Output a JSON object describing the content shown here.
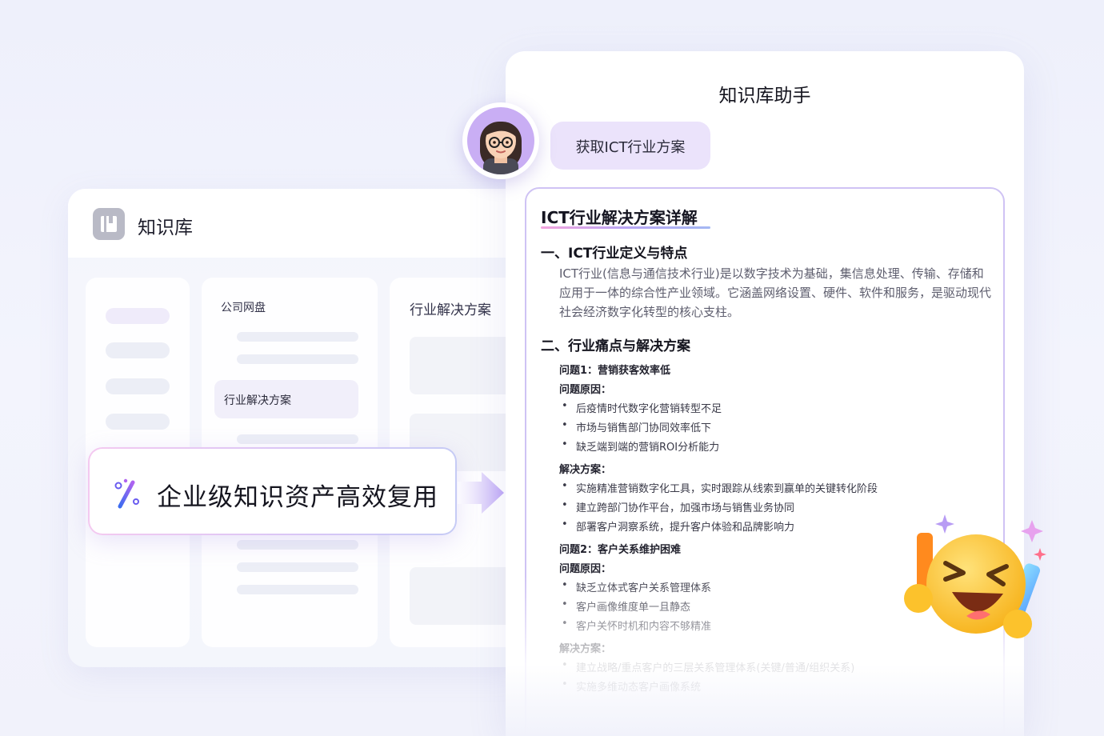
{
  "knowledge_base": {
    "title": "知识库",
    "folders": {
      "root_label": "公司网盘",
      "selected_item": "行业解决方案"
    },
    "content_title": "行业解决方案"
  },
  "callout": {
    "text": "企业级知识资产高效复用"
  },
  "assistant": {
    "title": "知识库助手",
    "user_message": "获取ICT行业方案",
    "answer": {
      "title": "ICT行业解决方案详解",
      "section1": {
        "heading": "一、ICT行业定义与特点",
        "body": "ICT行业(信息与通信技术行业)是以数字技术为基础，集信息处理、传输、存储和应用于一体的综合性产业领域。它涵盖网络设置、硬件、软件和服务，是驱动现代社会经济数字化转型的核心支柱。"
      },
      "section2": {
        "heading": "二、行业痛点与解决方案",
        "problem1": "问题1：营销获客效率低",
        "cause_label1": "问题原因：",
        "causes1": [
          "后疫情时代数字化营销转型不足",
          "市场与销售部门协同效率低下",
          "缺乏端到端的营销ROI分析能力"
        ],
        "solution_label1": "解决方案：",
        "solutions1": [
          "实施精准营销数字化工具，实时跟踪从线索到赢单的关键转化阶段",
          "建立跨部门协作平台，加强市场与销售业务协同",
          "部署客户洞察系统，提升客户体验和品牌影响力"
        ],
        "problem2": "问题2：客户关系维护困难",
        "cause_label2": "问题原因：",
        "causes2": [
          "缺乏立体式客户关系管理体系",
          "客户画像维度单一且静态",
          "客户关怀时机和内容不够精准"
        ],
        "solution_label2": "解决方案：",
        "solutions2": [
          "建立战略/重点客户的三层关系管理体系(关键/普通/组织关系)",
          "实施多维动态客户画像系统"
        ]
      }
    }
  },
  "colors": {
    "accent": "#cfc3f4",
    "bubble": "#ebe3fb",
    "background": "#eef0fb"
  },
  "icons": [
    "notebook-icon",
    "magic-wand-icon",
    "arrow-right-icon",
    "user-avatar",
    "laughing-emoji"
  ]
}
